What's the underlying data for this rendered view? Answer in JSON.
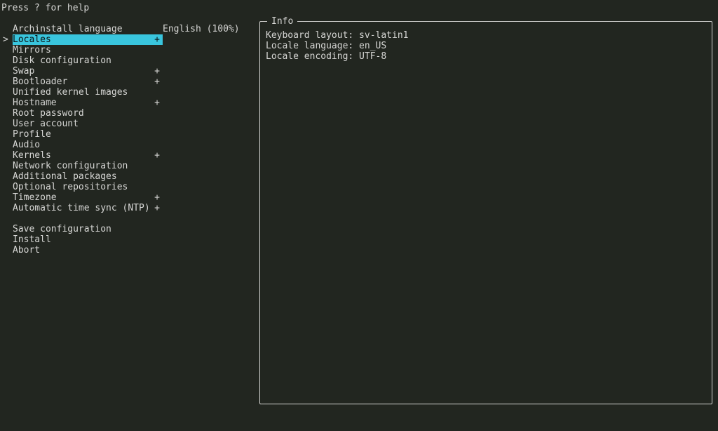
{
  "help_text": "Press ? for help",
  "cursor_index": 1,
  "menu": [
    {
      "label": "Archinstall language",
      "value": "English (100%)",
      "marker": ""
    },
    {
      "label": "Locales",
      "value": "",
      "marker": "+"
    },
    {
      "label": "Mirrors",
      "value": "",
      "marker": ""
    },
    {
      "label": "Disk configuration",
      "value": "",
      "marker": ""
    },
    {
      "label": "Swap",
      "value": "",
      "marker": "+"
    },
    {
      "label": "Bootloader",
      "value": "",
      "marker": "+"
    },
    {
      "label": "Unified kernel images",
      "value": "",
      "marker": ""
    },
    {
      "label": "Hostname",
      "value": "",
      "marker": "+"
    },
    {
      "label": "Root password",
      "value": "",
      "marker": ""
    },
    {
      "label": "User account",
      "value": "",
      "marker": ""
    },
    {
      "label": "Profile",
      "value": "",
      "marker": ""
    },
    {
      "label": "Audio",
      "value": "",
      "marker": ""
    },
    {
      "label": "Kernels",
      "value": "",
      "marker": "+"
    },
    {
      "label": "Network configuration",
      "value": "",
      "marker": ""
    },
    {
      "label": "Additional packages",
      "value": "",
      "marker": ""
    },
    {
      "label": "Optional repositories",
      "value": "",
      "marker": ""
    },
    {
      "label": "Timezone",
      "value": "",
      "marker": "+"
    },
    {
      "label": "Automatic time sync (NTP)",
      "value": "",
      "marker": "+"
    }
  ],
  "actions": [
    {
      "label": "Save configuration"
    },
    {
      "label": "Install"
    },
    {
      "label": "Abort"
    }
  ],
  "info": {
    "title": "Info",
    "lines": [
      "Keyboard layout: sv-latin1",
      "Locale language: en_US",
      "Locale encoding: UTF-8"
    ]
  },
  "glyph": {
    "cursor": ">"
  }
}
